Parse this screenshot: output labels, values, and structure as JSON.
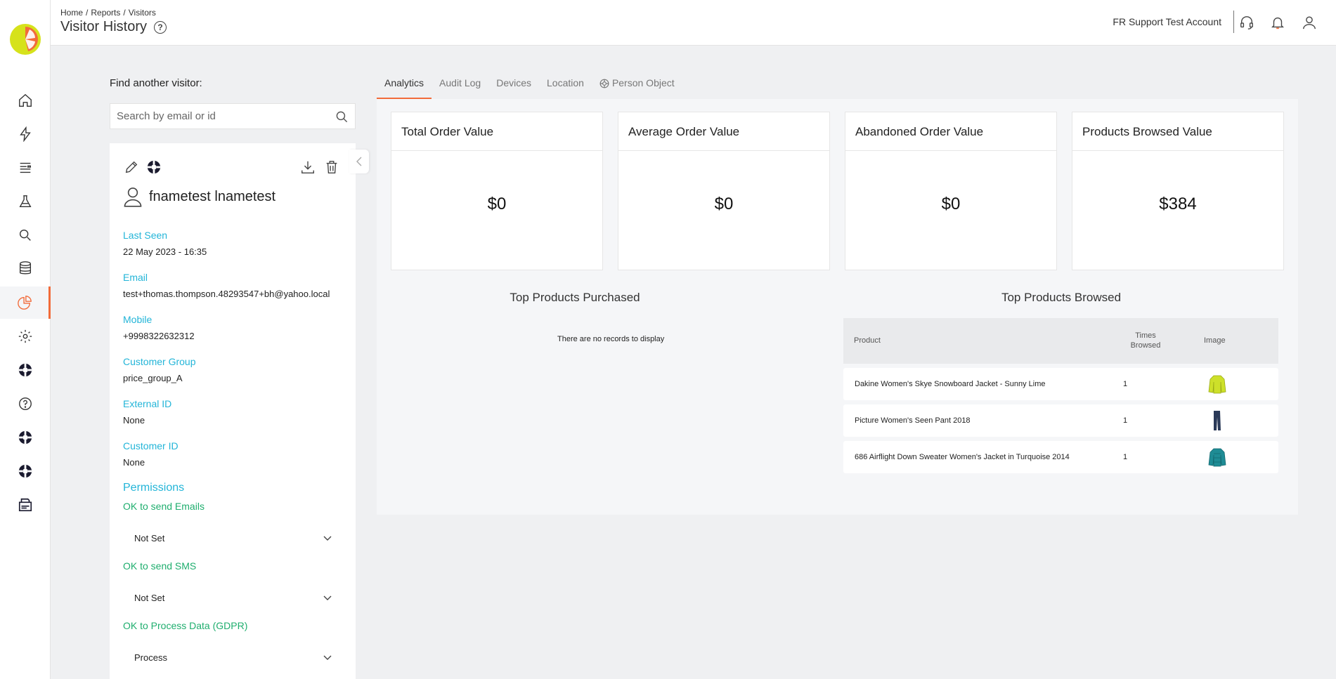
{
  "breadcrumb": [
    "Home",
    "Reports",
    "Visitors"
  ],
  "page_title": "Visitor History",
  "account_name": "FR Support Test Account",
  "colors": {
    "accent": "#f26b3a",
    "label_blue": "#23b5d8",
    "label_green": "#1fae6e"
  },
  "search": {
    "label": "Find another visitor:",
    "placeholder": "Search by email or id"
  },
  "visitor": {
    "name": "fnametest lnametest",
    "fields": [
      {
        "label": "Last Seen",
        "value": "22 May 2023 - 16:35"
      },
      {
        "label": "Email",
        "value": "test+thomas.thompson.48293547+bh@yahoo.local"
      },
      {
        "label": "Mobile",
        "value": "+9998322632312"
      },
      {
        "label": "Customer Group",
        "value": "price_group_A"
      },
      {
        "label": "External ID",
        "value": "None"
      },
      {
        "label": "Customer ID",
        "value": "None"
      }
    ]
  },
  "permissions": {
    "heading": "Permissions",
    "items": [
      {
        "label": "OK to send Emails",
        "value": "Not Set"
      },
      {
        "label": "OK to send SMS",
        "value": "Not Set"
      },
      {
        "label": "OK to Process Data (GDPR)",
        "value": "Process"
      }
    ]
  },
  "tabs": [
    "Analytics",
    "Audit Log",
    "Devices",
    "Location",
    "Person Object"
  ],
  "kpis": [
    {
      "title": "Total Order Value",
      "value": "$0"
    },
    {
      "title": "Average Order Value",
      "value": "$0"
    },
    {
      "title": "Abandoned Order Value",
      "value": "$0"
    },
    {
      "title": "Products Browsed Value",
      "value": "$384"
    }
  ],
  "top_purchased": {
    "title": "Top Products Purchased",
    "empty": "There are no records to display"
  },
  "top_browsed": {
    "title": "Top Products Browsed",
    "columns": {
      "product": "Product",
      "times_browsed": "Times Browsed",
      "image": "Image"
    },
    "rows": [
      {
        "product": "Dakine Women's Skye Snowboard Jacket - Sunny Lime",
        "times": "1",
        "image": "lime-jacket-image"
      },
      {
        "product": "Picture Women's Seen Pant 2018",
        "times": "1",
        "image": "navy-pant-image"
      },
      {
        "product": "686 Airflight Down Sweater Women's Jacket in Turquoise 2014",
        "times": "1",
        "image": "turquoise-jacket-image"
      }
    ]
  },
  "nav_icons": [
    "home-icon",
    "lightning-icon",
    "list-icon",
    "flask-icon",
    "search-icon",
    "database-icon",
    "pie-chart-icon",
    "gear-icon",
    "lifebuoy-icon",
    "help-icon",
    "lifebuoy-icon",
    "lifebuoy-icon",
    "printer-icon"
  ]
}
